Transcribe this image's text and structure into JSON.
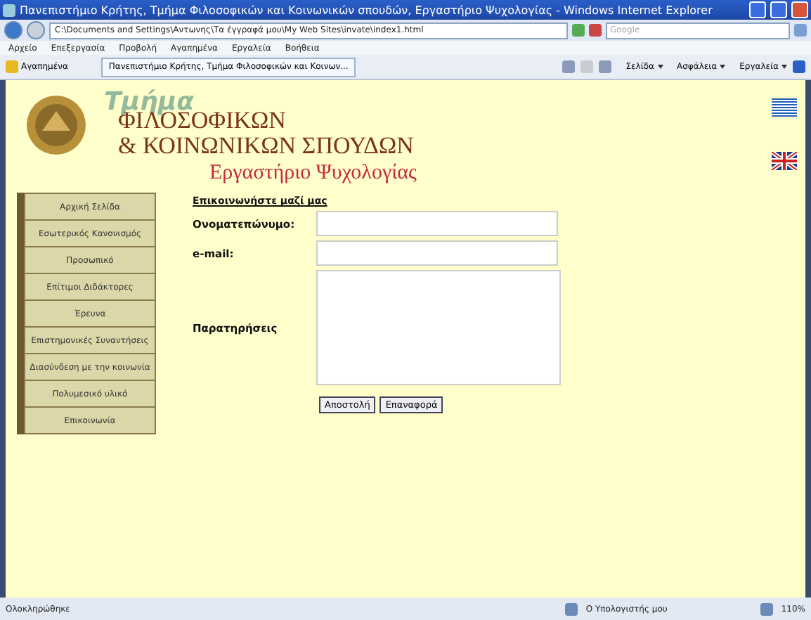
{
  "window": {
    "title": "Πανεπιστήμιο Κρήτης, Τμήμα Φιλοσοφικών και Κοινωνικών σπουδών, Εργαστήριο Ψυχολογίας - Windows Internet Explorer"
  },
  "address_bar": {
    "url": "C:\\Documents and Settings\\Αντωνης\\Τα έγγραφά μου\\My Web Sites\\invate\\index1.html",
    "search_placeholder": "Google"
  },
  "menu": [
    "Αρχείο",
    "Επεξεργασία",
    "Προβολή",
    "Αγαπημένα",
    "Εργαλεία",
    "Βοήθεια"
  ],
  "favorites_bar": {
    "favorites": "Αγαπημένα",
    "tabs": [
      {
        "label": "Πανεπιστήμιο Κρήτης, Τμήμα Φιλοσοφικών και Κοινων...",
        "selected": true
      }
    ],
    "commands": [
      "Σελίδα",
      "Ασφάλεια",
      "Εργαλεία"
    ]
  },
  "header": {
    "logo_word": "Τμήμα",
    "line_1": "ΦΙΛΟΣΟΦΙΚΩΝ",
    "line_2": "& ΚΟΙΝΩΝΙΚΩΝ ΣΠΟΥΔΩΝ",
    "subtitle": "Εργαστήριο Ψυχολογίας"
  },
  "sidebar": {
    "items": [
      {
        "label": "Αρχική Σελίδα"
      },
      {
        "label": "Εσωτερικός Κανονισμός"
      },
      {
        "label": "Προσωπικό"
      },
      {
        "label": "Επίτιμοι Διδάκτορες"
      },
      {
        "label": "Έρευνα"
      },
      {
        "label": "Επιστημονικές Συναντήσεις"
      },
      {
        "label": "Διασύνδεση με την κοινωνία"
      },
      {
        "label": "Πολυμεσικό υλικό"
      },
      {
        "label": "Επικοινωνία"
      }
    ]
  },
  "form": {
    "heading": "Επικοινωνήστε μαζί μας",
    "fields": [
      {
        "label": "Ονοματεπώνυμο:",
        "kind": "text"
      },
      {
        "label": "e-mail:",
        "kind": "text"
      },
      {
        "label": "Παρατηρήσεις",
        "kind": "textarea"
      }
    ],
    "buttons": [
      "Αποστολή",
      "Επαναφορά"
    ]
  },
  "status_bar": {
    "status": "Ολοκληρώθηκε",
    "zone": "Ο Υπολογιστής μου",
    "zoom": "110%"
  }
}
